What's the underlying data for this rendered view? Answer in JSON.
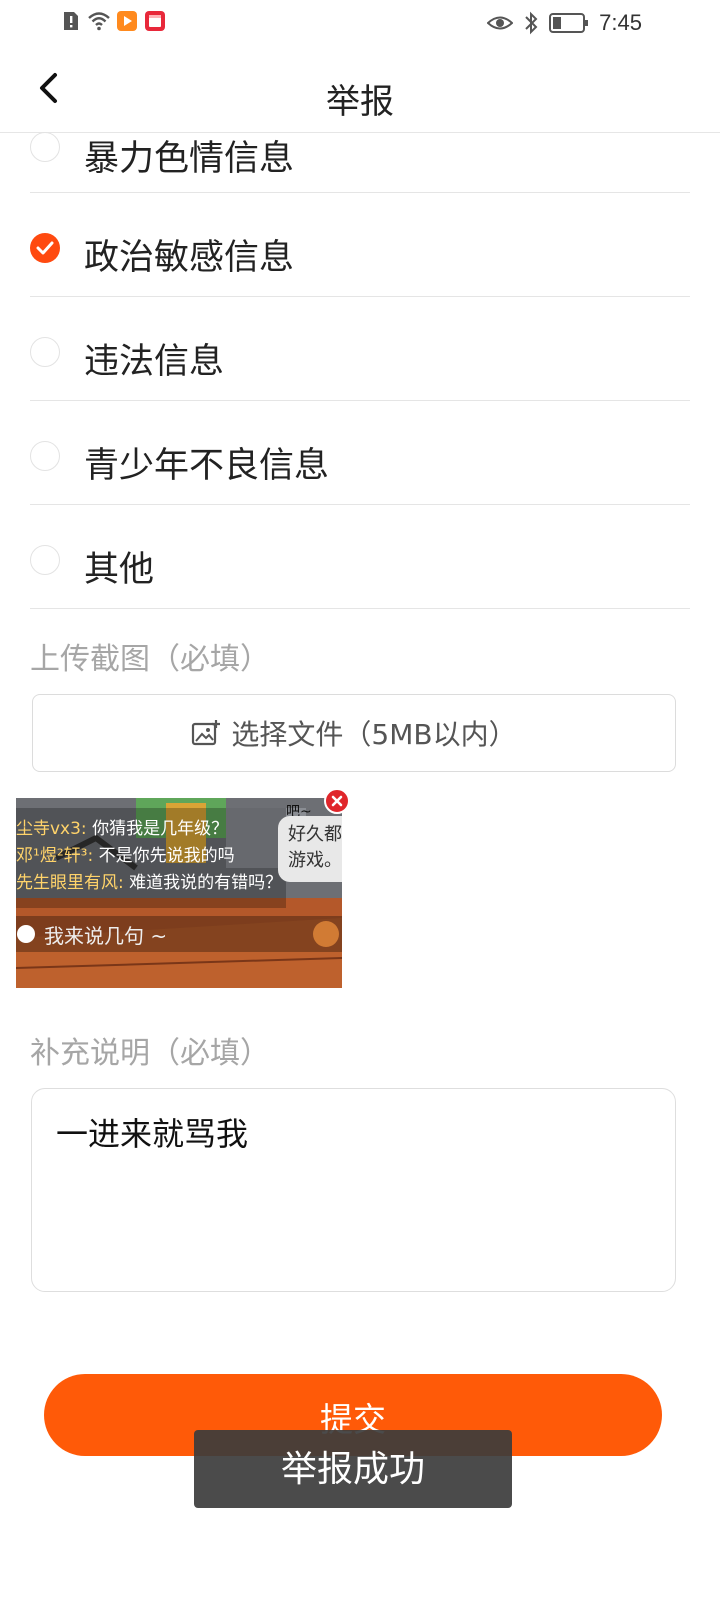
{
  "status_bar": {
    "time": "7:45",
    "left_icons": [
      "alert-icon",
      "wifi-icon",
      "video-app-icon",
      "calendar-app-icon"
    ],
    "right_icons": [
      "eye-icon",
      "bluetooth-icon",
      "battery-icon"
    ]
  },
  "header": {
    "title": "举报",
    "back_icon": "chevron-left-icon"
  },
  "report_options": [
    {
      "label": "暴力色情信息",
      "checked": false
    },
    {
      "label": "政治敏感信息",
      "checked": true
    },
    {
      "label": "违法信息",
      "checked": false
    },
    {
      "label": "青少年不良信息",
      "checked": false
    },
    {
      "label": "其他",
      "checked": false
    }
  ],
  "upload": {
    "section_label": "上传截图（必填）",
    "button_label": "选择文件（5MB以内）",
    "button_icon": "image-upload-icon"
  },
  "screenshot": {
    "top_text": "吧~",
    "chat": [
      {
        "name": "尘寺vx3:",
        "text": "你猜我是几年级？"
      },
      {
        "name": "邓¹煜²轩³:",
        "text": "不是你先说我的吗"
      },
      {
        "name": "先生眼里有风:",
        "text": "难道我说的有错吗？"
      }
    ],
    "bubble_text": [
      "好久都",
      "游戏。"
    ],
    "input_placeholder": "我来说几句 ~",
    "remove_icon": "close-icon"
  },
  "description": {
    "section_label": "补充说明（必填）",
    "value": "一进来就骂我"
  },
  "submit": {
    "label": "提交"
  },
  "toast": {
    "message": "举报成功"
  },
  "colors": {
    "accent": "#ff5a08",
    "check": "#ff4a10",
    "muted": "#a6a6a6"
  }
}
